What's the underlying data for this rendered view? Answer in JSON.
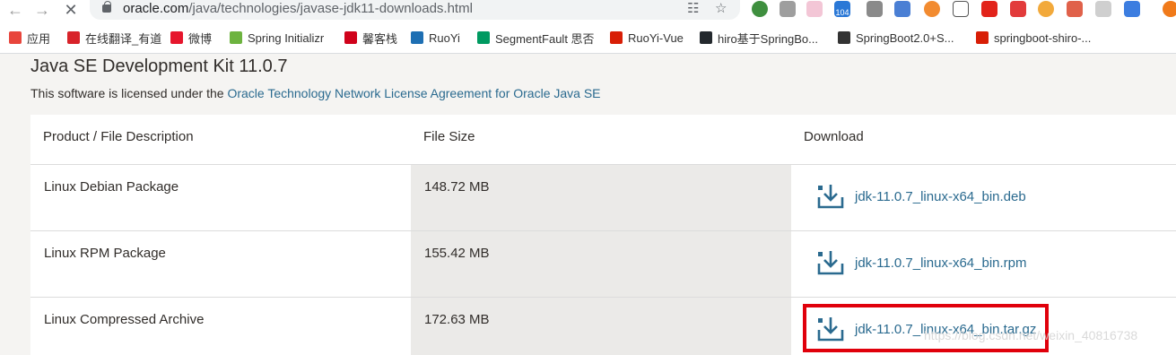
{
  "browser": {
    "url_host": "oracle.com",
    "url_path": "/java/technologies/javase-jdk11-downloads.html",
    "ext_badge": "104"
  },
  "bookmarks": [
    {
      "label": "应用",
      "color": "#e8453c"
    },
    {
      "label": "在线翻译_有道",
      "color": "#d8232a"
    },
    {
      "label": "微博",
      "color": "#e6162d"
    },
    {
      "label": "Spring Initializr",
      "color": "#6db33f"
    },
    {
      "label": "馨客栈",
      "color": "#d0021b"
    },
    {
      "label": "RuoYi",
      "color": "#1e6fb3"
    },
    {
      "label": "SegmentFault 思否",
      "color": "#009a61"
    },
    {
      "label": "RuoYi-Vue",
      "color": "#d81e06"
    },
    {
      "label": "hiro基于SpringBo...",
      "color": "#24292e"
    },
    {
      "label": "SpringBoot2.0+S...",
      "color": "#333333"
    },
    {
      "label": "springboot-shiro-...",
      "color": "#d81e06"
    }
  ],
  "page": {
    "title": "Java SE Development Kit 11.0.7",
    "license_prefix": "This software is licensed under the ",
    "license_link": "Oracle Technology Network License Agreement for Oracle Java SE"
  },
  "table": {
    "headers": [
      "Product / File Description",
      "File Size",
      "Download"
    ],
    "rows": [
      {
        "description": "Linux Debian Package",
        "size": "148.72 MB",
        "file": "jdk-11.0.7_linux-x64_bin.deb"
      },
      {
        "description": "Linux RPM Package",
        "size": "155.42 MB",
        "file": "jdk-11.0.7_linux-x64_bin.rpm"
      },
      {
        "description": "Linux Compressed Archive",
        "size": "172.63 MB",
        "file": "jdk-11.0.7_linux-x64_bin.tar.gz"
      }
    ]
  },
  "watermark": "https://blog.csdn.net/weixin_40816738",
  "colors": {
    "link": "#2a6a8f",
    "highlight": "#e0000b",
    "text": "#312d2a"
  }
}
